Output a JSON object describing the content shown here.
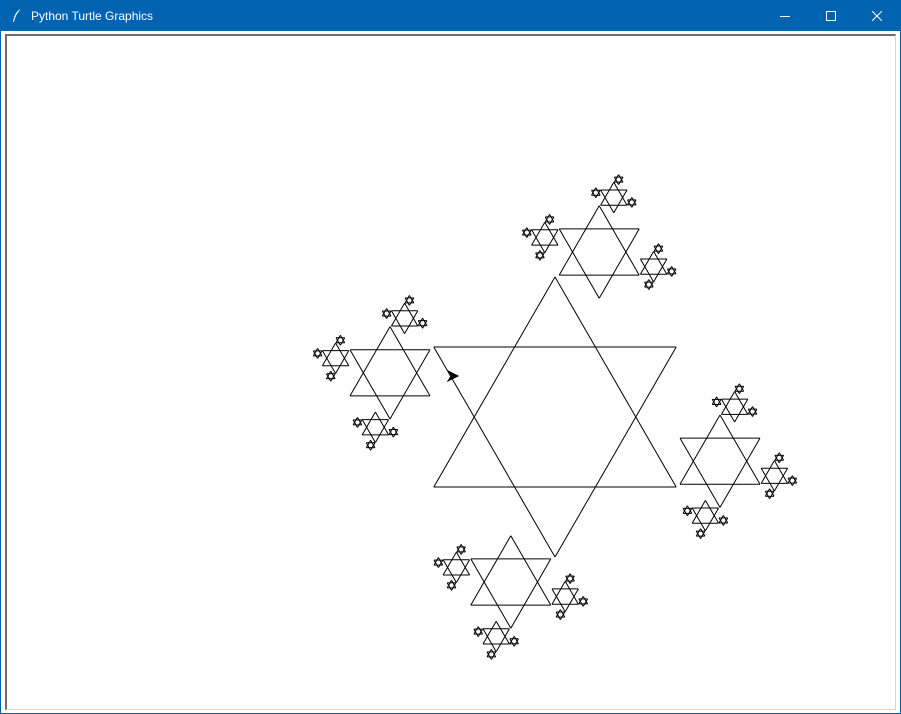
{
  "window": {
    "title": "Python Turtle Graphics",
    "app_icon": "feather-pen-icon",
    "accent_color": "#0063b1",
    "controls": {
      "minimize_icon": "minimize-icon",
      "maximize_icon": "maximize-icon",
      "close_icon": "close-icon"
    }
  },
  "canvas": {
    "background": "#ffffff",
    "stroke_color": "#000000",
    "drawing": "recursive-star-fractal",
    "star_points": 6,
    "recursion_depth": 3,
    "turtle_cursor": "arrow"
  }
}
